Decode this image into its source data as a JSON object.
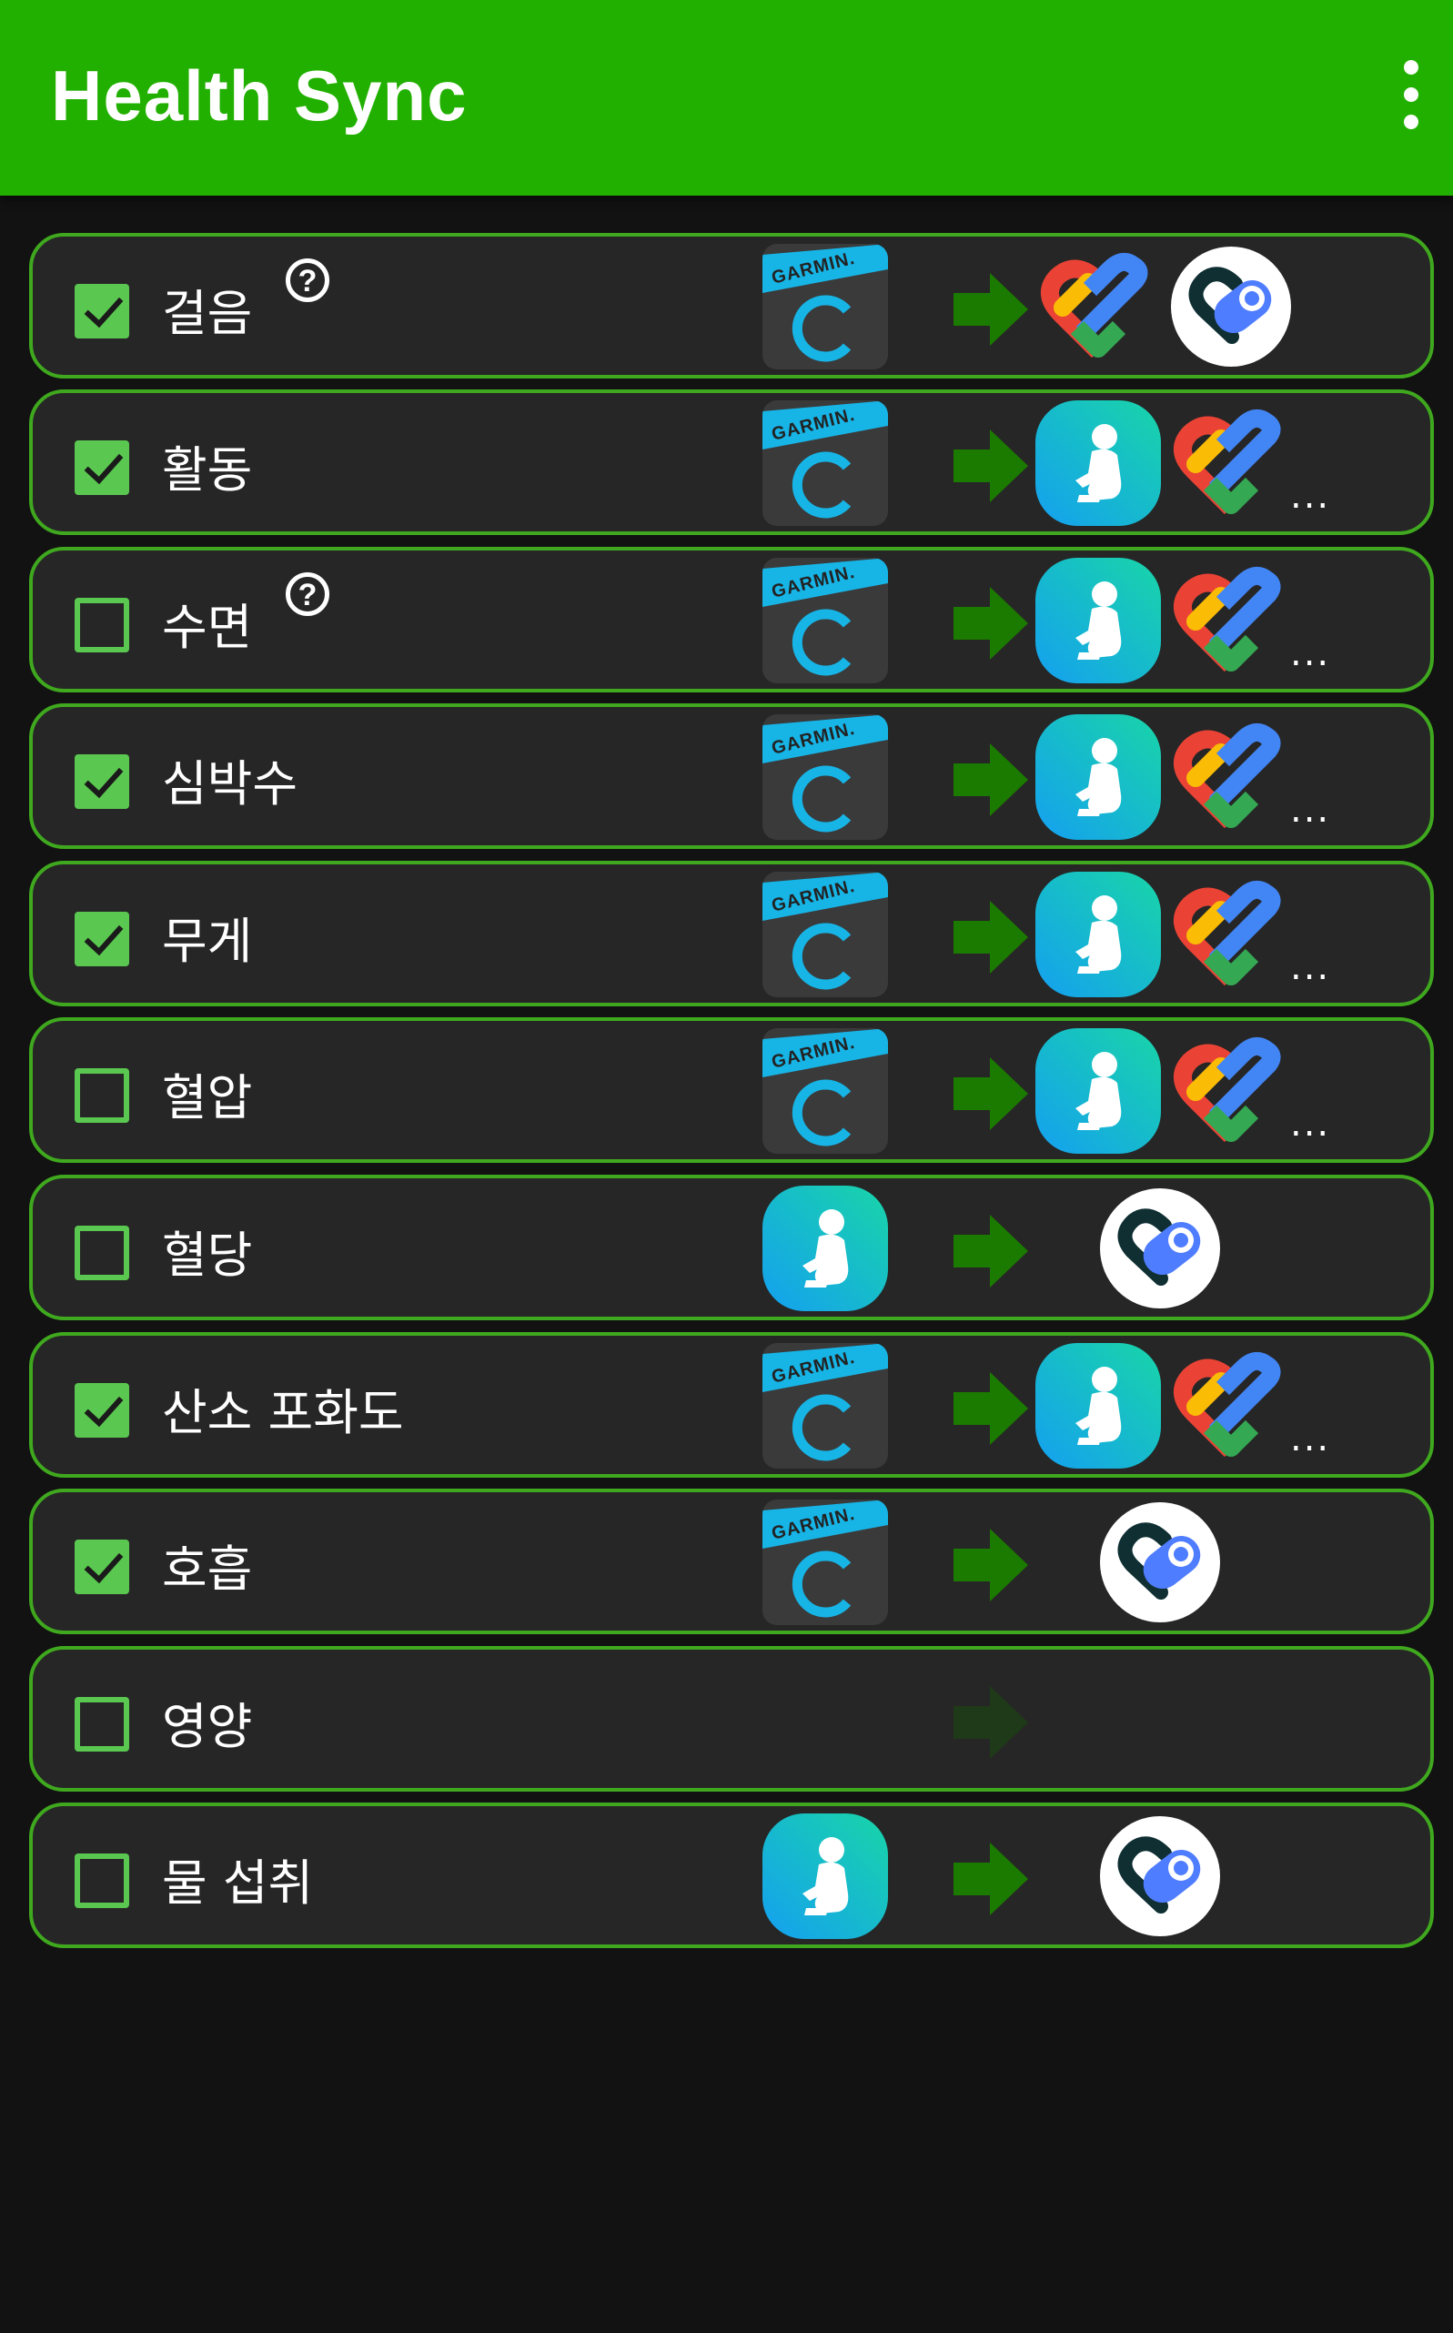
{
  "app": {
    "title": "Health Sync"
  },
  "icons": {
    "overflow": "more-vert-icon",
    "help": "help-circle-icon",
    "source_garmin": "garmin-connect-icon",
    "source_samsung": "samsung-health-icon",
    "arrow": "arrow-right-icon",
    "dest_samsung": "samsung-health-icon",
    "dest_google_fit": "google-fit-icon",
    "dest_health_connect": "health-connect-icon"
  },
  "colors": {
    "app_bar": "#22b000",
    "row_border": "#3fa81e",
    "checkbox": "#5ac850",
    "arrow": "#1b7a00",
    "background": "#121212",
    "row_background": "#262626"
  },
  "sync_items": [
    {
      "label": "걸음",
      "checked": true,
      "help": true,
      "help_symbol": "?",
      "source": "garmin",
      "destinations": [
        "google-fit",
        "health-connect"
      ],
      "more": ""
    },
    {
      "label": "활동",
      "checked": true,
      "help": false,
      "source": "garmin",
      "destinations": [
        "samsung-health",
        "google-fit"
      ],
      "more": "..."
    },
    {
      "label": "수면",
      "checked": false,
      "help": true,
      "help_symbol": "?",
      "source": "garmin",
      "destinations": [
        "samsung-health",
        "google-fit"
      ],
      "more": "..."
    },
    {
      "label": "심박수",
      "checked": true,
      "help": false,
      "source": "garmin",
      "destinations": [
        "samsung-health",
        "google-fit"
      ],
      "more": "..."
    },
    {
      "label": "무게",
      "checked": true,
      "help": false,
      "source": "garmin",
      "destinations": [
        "samsung-health",
        "google-fit"
      ],
      "more": "..."
    },
    {
      "label": "혈압",
      "checked": false,
      "help": false,
      "source": "garmin",
      "destinations": [
        "samsung-health",
        "google-fit"
      ],
      "more": "..."
    },
    {
      "label": "혈당",
      "checked": false,
      "help": false,
      "source": "samsung-health",
      "destinations": [
        "health-connect"
      ],
      "more": ""
    },
    {
      "label": "산소 포화도",
      "checked": true,
      "help": false,
      "source": "garmin",
      "destinations": [
        "samsung-health",
        "google-fit"
      ],
      "more": "..."
    },
    {
      "label": "호흡",
      "checked": true,
      "help": false,
      "source": "garmin",
      "destinations": [
        "health-connect"
      ],
      "more": ""
    },
    {
      "label": "영양",
      "checked": false,
      "help": false,
      "source": null,
      "destinations": [],
      "more": "",
      "arrow_dimmed": true
    },
    {
      "label": "물 섭취",
      "checked": false,
      "help": false,
      "source": "samsung-health",
      "destinations": [
        "health-connect"
      ],
      "more": ""
    }
  ]
}
